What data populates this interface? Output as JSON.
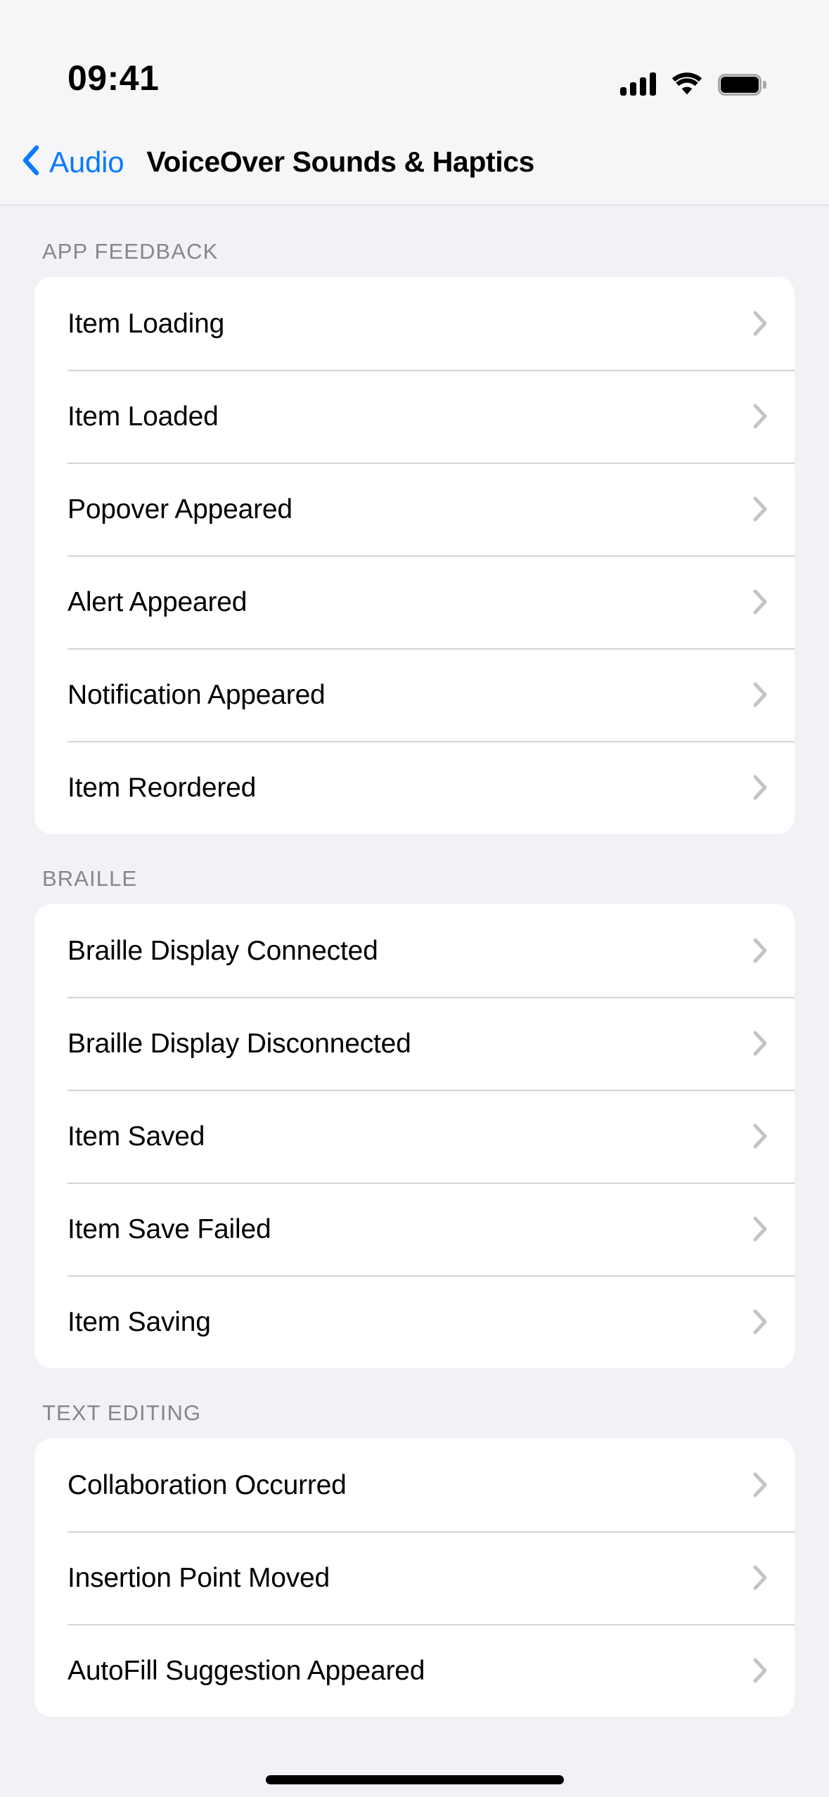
{
  "status_bar": {
    "time": "09:41",
    "cellular_icon": "cellular-bars-icon",
    "cellular_bars": 4,
    "wifi_icon": "wifi-icon",
    "battery_icon": "battery-full-icon"
  },
  "nav_bar": {
    "back_icon": "chevron-left-icon",
    "back_label": "Audio",
    "title": "VoiceOver Sounds & Haptics"
  },
  "colors": {
    "accent": "#0a7aff",
    "background": "#f1f1f6",
    "card": "#ffffff",
    "separator": "#d4d4d8",
    "section_header_text": "#86868e",
    "chevron": "#c4c4c8"
  },
  "sections": [
    {
      "header": "APP FEEDBACK",
      "rows": [
        {
          "label": "Item Loading",
          "accessory": "chevron-right-icon"
        },
        {
          "label": "Item Loaded",
          "accessory": "chevron-right-icon"
        },
        {
          "label": "Popover Appeared",
          "accessory": "chevron-right-icon"
        },
        {
          "label": "Alert Appeared",
          "accessory": "chevron-right-icon"
        },
        {
          "label": "Notification Appeared",
          "accessory": "chevron-right-icon"
        },
        {
          "label": "Item Reordered",
          "accessory": "chevron-right-icon"
        }
      ]
    },
    {
      "header": "BRAILLE",
      "rows": [
        {
          "label": "Braille Display Connected",
          "accessory": "chevron-right-icon"
        },
        {
          "label": "Braille Display Disconnected",
          "accessory": "chevron-right-icon"
        },
        {
          "label": "Item Saved",
          "accessory": "chevron-right-icon"
        },
        {
          "label": "Item Save Failed",
          "accessory": "chevron-right-icon"
        },
        {
          "label": "Item Saving",
          "accessory": "chevron-right-icon"
        }
      ]
    },
    {
      "header": "TEXT EDITING",
      "rows": [
        {
          "label": "Collaboration Occurred",
          "accessory": "chevron-right-icon"
        },
        {
          "label": "Insertion Point Moved",
          "accessory": "chevron-right-icon"
        },
        {
          "label": "AutoFill Suggestion Appeared",
          "accessory": "chevron-right-icon"
        }
      ]
    }
  ],
  "home_indicator": "home-indicator-bar"
}
